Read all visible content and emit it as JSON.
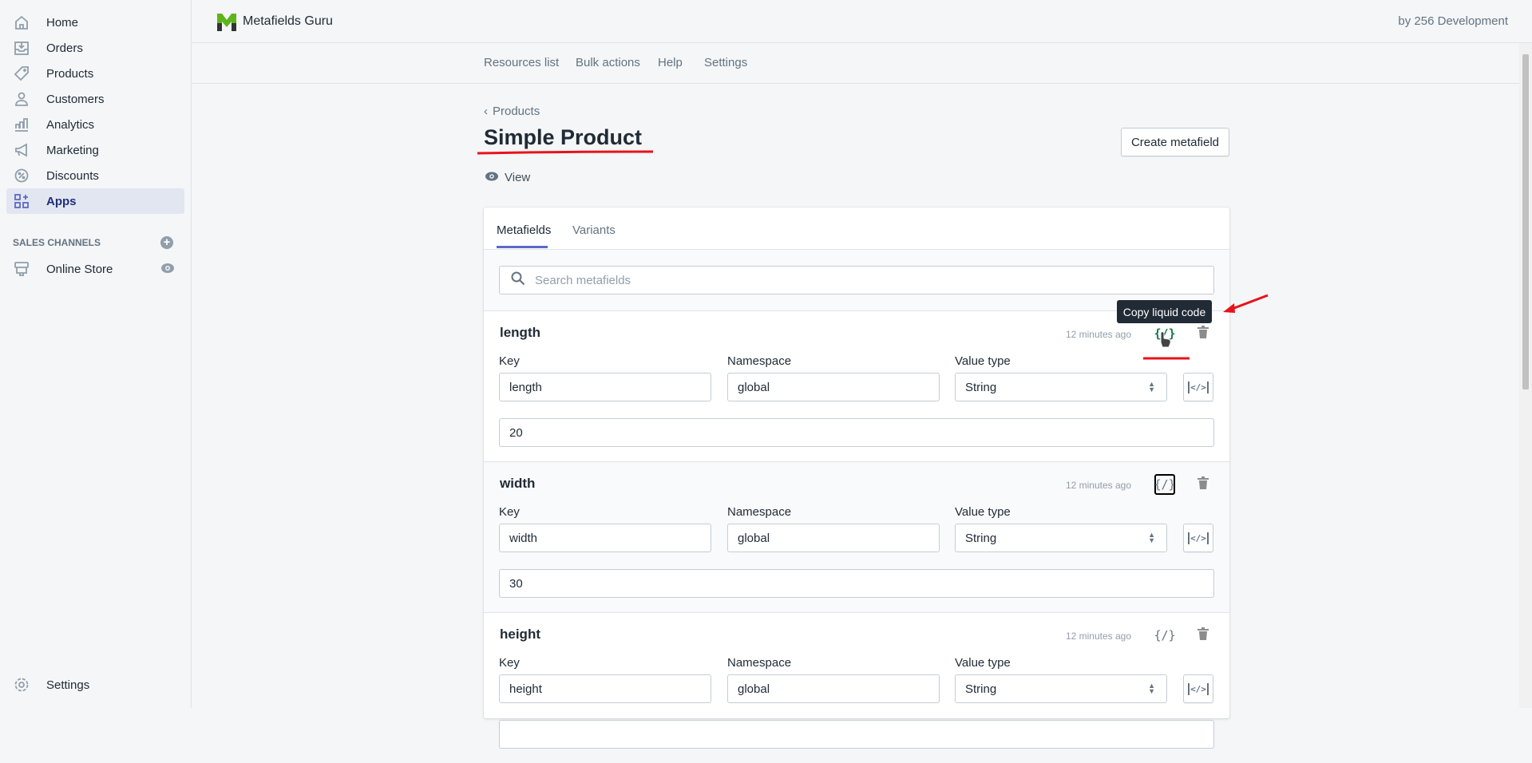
{
  "sidebar": {
    "items": [
      {
        "label": "Home",
        "icon": "home-icon"
      },
      {
        "label": "Orders",
        "icon": "orders-icon"
      },
      {
        "label": "Products",
        "icon": "tag-icon"
      },
      {
        "label": "Customers",
        "icon": "person-icon"
      },
      {
        "label": "Analytics",
        "icon": "bar-chart-icon"
      },
      {
        "label": "Marketing",
        "icon": "megaphone-icon"
      },
      {
        "label": "Discounts",
        "icon": "discount-icon"
      },
      {
        "label": "Apps",
        "icon": "apps-icon",
        "active": true
      }
    ],
    "sales_channels_title": "SALES CHANNELS",
    "online_store": "Online Store",
    "settings": "Settings"
  },
  "topbar": {
    "app_name": "Metafields Guru",
    "developer": "by 256 Development"
  },
  "app_nav": [
    "Resources list",
    "Bulk actions",
    "Help",
    "Settings"
  ],
  "page": {
    "breadcrumb": "Products",
    "title": "Simple Product",
    "view_label": "View",
    "create_button": "Create metafield"
  },
  "tabs": [
    {
      "label": "Metafields",
      "active": true
    },
    {
      "label": "Variants"
    }
  ],
  "search": {
    "placeholder": "Search metafields"
  },
  "field_labels": {
    "key": "Key",
    "namespace": "Namespace",
    "value_type": "Value type"
  },
  "tooltip": "Copy liquid code",
  "accent": "#5c6ac4",
  "metafields": [
    {
      "name": "length",
      "updated": "12 minutes ago",
      "key": "length",
      "namespace": "global",
      "value_type": "String",
      "value": "20"
    },
    {
      "name": "width",
      "updated": "12 minutes ago",
      "key": "width",
      "namespace": "global",
      "value_type": "String",
      "value": "30"
    },
    {
      "name": "height",
      "updated": "12 minutes ago",
      "key": "height",
      "namespace": "global",
      "value_type": "String",
      "value": ""
    }
  ]
}
